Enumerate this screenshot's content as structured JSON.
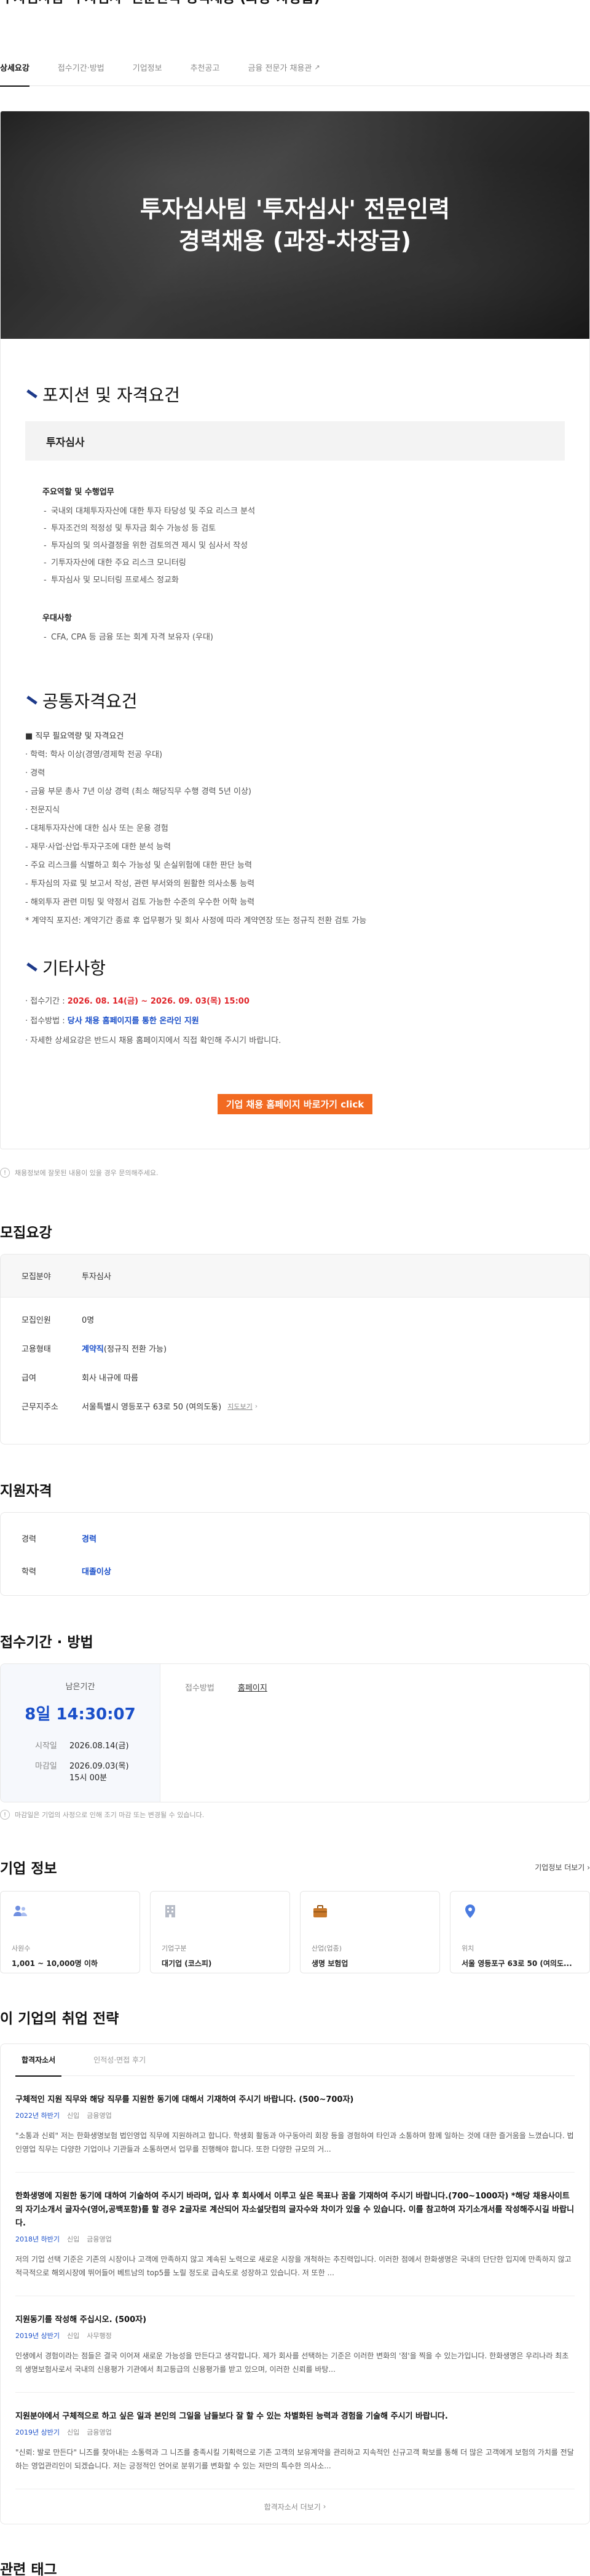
{
  "top_title": "투자심사팀 '투자심사' 전문인력 경력채용 (과장-차장급)",
  "tabs": [
    {
      "label": "상세요강"
    },
    {
      "label": "접수기간·방법"
    },
    {
      "label": "기업정보"
    },
    {
      "label": "추천공고"
    },
    {
      "label": "금융 전문가 채용관"
    }
  ],
  "hero": {
    "line1": "투자심사팀 '투자심사' 전문인력",
    "line2": "경력채용 (과장-차장급)"
  },
  "position": {
    "heading": "포지션 및 자격요건",
    "subtitle": "투자심사",
    "duties_title": "주요역할 및 수행업무",
    "duties": [
      "국내외 대체투자자산에 대한 투자 타당성 및 주요 리스크 분석",
      "투자조건의 적정성 및 투자금 회수 가능성 등 검토",
      "투자심의 및 의사결정을 위한 검토의견 제시 및 심사서 작성",
      "기투자자산에 대한 주요 리스크 모니터링",
      "투자심사 및 모니터링 프로세스 정교화"
    ],
    "pref_title": "우대사항",
    "prefs": [
      "CFA, CPA 등 금융 또는 회계 자격 보유자 (우대)"
    ]
  },
  "common": {
    "heading": "공통자격요건",
    "lines": [
      "■ 직무 필요역량 및 자격요건",
      "· 학력: 학사 이상(경영/경제학 전공 우대)",
      "· 경력",
      "  - 금융 부문 총사 7년 이상 경력 (최소 해당직무 수행 경력 5년 이상)",
      "· 전문지식",
      "  - 대체투자자산에 대한 심사 또는 운용 경험",
      "  - 재무·사업·산업·투자구조에 대한 분석 능력",
      "  - 주요 리스크를 식별하고 회수 가능성 및 손실위험에 대한 판단 능력",
      "  - 투자심의 자료 및 보고서 작성, 관련 부서와의 원활한 의사소통 능력",
      "  - 해외투자 관련 미팅 및 약정서 검토 가능한 수준의 우수한 어학 능력",
      "  * 계약직 포지션: 계약기간 종료 후 업무평가 및 회사 사정에 따라 계약연장 또는 정규직 전환 검토 가능"
    ]
  },
  "etc": {
    "heading": "기타사항",
    "period_label": "· 접수기간 : ",
    "period_value": "2026. 08. 14(금) ~ 2026. 09. 03(목) 15:00",
    "method_label": "· 접수방법 : ",
    "method_value": "당사 채용 홈페이지를 통한 온라인 지원",
    "note": "· 자세한 상세요강은 반드시 채용 홈페이지에서 직접 확인해 주시기 바랍니다."
  },
  "apply_button": "기업 채용 홈페이지 바로가기 click",
  "notice1": "채용정보에 잘못된 내용이 있을 경우 문의해주세요.",
  "summary": {
    "heading": "모집요강",
    "field_label": "모집분야",
    "field_value": "투자심사",
    "rows": [
      {
        "k": "모집인원",
        "v": "0명"
      },
      {
        "k": "고용형태",
        "v_bold": "계약직",
        "v": "(정규직 전환 가능)"
      },
      {
        "k": "급여",
        "v": "회사 내규에 따름"
      },
      {
        "k": "근무지주소",
        "v": "서울특별시 영등포구 63로 50 (여의도동)",
        "link": "지도보기"
      }
    ]
  },
  "qual": {
    "heading": "지원자격",
    "rows": [
      {
        "k": "경력",
        "v": "경력"
      },
      {
        "k": "학력",
        "v": "대졸이상"
      }
    ]
  },
  "deadline": {
    "heading": "접수기간 · 방법",
    "remaining_label": "남은기간",
    "remaining": "8일 14:30:07",
    "start_label": "시작일",
    "start": "2026.08.14(금)",
    "end_label": "마감일",
    "end": "2026.09.03(목)",
    "end_time": "15시 00분",
    "method_label": "접수방법",
    "method": "홈페이지"
  },
  "notice2": "마감일은 기업의 사정으로 인해 조기 마감 또는 변경될 수 있습니다.",
  "company": {
    "heading": "기업 정보",
    "more": "기업정보 더보기",
    "cards": [
      {
        "icon": "people-icon",
        "label": "사원수",
        "value": "1,001 ~ 10,000명 이하"
      },
      {
        "icon": "building-icon",
        "label": "기업구분",
        "value": "대기업 (코스피)"
      },
      {
        "icon": "briefcase-icon",
        "label": "산업(업종)",
        "value": "생명 보험업"
      },
      {
        "icon": "location-icon",
        "label": "위치",
        "value": "서울 영등포구 63로 50 (여의도..."
      }
    ]
  },
  "strategy": {
    "heading": "이 기업의 취업 전략",
    "tabs": [
      "합격자소서",
      "인적성·면접 후기"
    ],
    "items": [
      {
        "q": "구체적인 지원 직무와 해당 직무를 지원한 동기에 대해서 기재하여 주시기 바랍니다. (500~700자)",
        "year": "2022년 하반기",
        "type": "신입",
        "job": "금융영업",
        "a": "\"소통과 신뢰\" 저는 한화생명보험 법인영업 직무에 지원하려고 합니다. 학생회 활동과 아구동아리 회장 등을 경험하여 타인과 소통하며 함께 일하는 것에 대한 즐거움을 느꼈습니다. 법인영업 직무는 다양한 기업이나 기관들과 소통하면서 업무를 진행해야 합니다. 또한 다양한 규모의 거..."
      },
      {
        "q": "한화생명에 지원한 동기에 대하여 기술하여 주시기 바라며, 입사 후 회사에서 이루고 싶은 목표나 꿈을 기재하여 주시기 바랍니다.(700~1000자) *해당 채용사이트의 자기소개서 글자수(영어,공백포함)를 할 경우 2글자로 계산되어 자소설닷컴의 글자수와 차이가 있을 수 있습니다. 이를 참고하여 자기소개서를 작성해주시길 바랍니다.",
        "year": "2018년 하반기",
        "type": "신입",
        "job": "금융영업",
        "a": "저의 기업 선택 기준은 기존의 시장이나 고객에 만족하지 않고 계속된 노력으로 새로운 시장을 개척하는 추진력입니다. 이러한 점에서 한화생명은 국내의 단단한 입지에 만족하지 않고 적극적으로 해외시장에 뛰어들어 베트남의 top5를 노릴 정도로 급속도로 성장하고 있습니다. 저 또한 ..."
      },
      {
        "q": "지원동기를 작성해 주십시오. (500자)",
        "year": "2019년 상반기",
        "type": "신입",
        "job": "사무행정",
        "a": "인생에서 경험이라는 점들은 결국 이어져 새로운 가능성을 만든다고 생각합니다. 제가 회사를 선택하는 기준은 이러한 변화의 '점'을 찍을 수 있는가입니다. 한화생명은 우리나라 최초의 생명보험사로서 국내의 신용평가 기관에서 최고등급의 신용평가를 받고 있으며, 이러한 신뢰를 바탕..."
      },
      {
        "q": "지원분야에서 구체적으로 하고 싶은 일과 본인의 그일을 남들보다 잘 할 수 있는 차별화된 능력과 경험을 기술해 주시기 바랍니다.",
        "year": "2019년 상반기",
        "type": "신입",
        "job": "금융영업",
        "a": "\"신뢰: 발로 만든다\" 니즈를 찾아내는 소통력과 그 니즈를 충족시킬 기획력으로 기존 고객의 보유계약을 관리하고 지속적인 신규고객 확보를 통해 더 많은 고객에게 보험의 가치를 전달하는 영업관리인이 되겠습니다. 저는 긍정적인 언어로 분위기를 변화할 수 있는 저만의 특수한 의사소..."
      }
    ],
    "more": "합격자소서 더보기"
  },
  "tags_heading": "관련 태그"
}
